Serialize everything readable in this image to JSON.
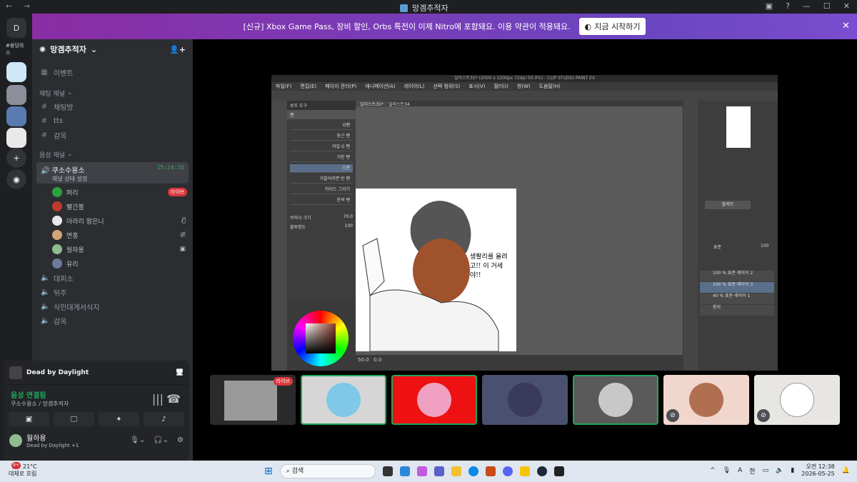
{
  "window": {
    "title": "망겜추적자",
    "nav": "← →"
  },
  "banner": {
    "text": "[신규] Xbox Game Pass, 장비 할인, Orbs 특전이 이제 Nitro에 포함돼요. 이용 약관이 적용돼요.",
    "button": "지금 시작하기",
    "close": "✕"
  },
  "servers": [
    {
      "name": "discord-home",
      "label": "D"
    },
    {
      "name": "server-1",
      "label": "#용딩의스"
    }
  ],
  "sidebar": {
    "guild_name": "망겜추적자",
    "events": "이벤트",
    "text_category": "채팅 채널",
    "text_channels": [
      "채팅방",
      "tts",
      "감옥"
    ],
    "voice_category": "음성 채널",
    "active_voice": {
      "name": "쿠소수용소",
      "time": "15:24:35",
      "status": "채널 상태 설정"
    },
    "voice_users": [
      {
        "name": "퍼리",
        "live": "라이브",
        "color": "#2ea043"
      },
      {
        "name": "빨간볼",
        "color": "#c0392b"
      },
      {
        "name": "아라리 왕은니",
        "color": "#e8e8e8"
      },
      {
        "name": "면홍",
        "color": "#d2a679"
      },
      {
        "name": "월하용",
        "color": "#8fbc8f"
      },
      {
        "name": "유리",
        "color": "#6c7a9c"
      }
    ],
    "other_voice": [
      "대피소",
      "뒤주",
      "식인대게서식지",
      "감옥"
    ]
  },
  "panel": {
    "activity": "Dead by Daylight",
    "voice_connected": "음성 연결됨",
    "voice_location": "쿠소수용소 / 망겜추적자",
    "username": "월하용",
    "user_status": "Dead by Daylight +1"
  },
  "csp": {
    "title": "일러스트35* (2000 x 3200px 72dpi 50.0%) - CLIP STUDIO PAINT EX",
    "menu": [
      "파일(F)",
      "편집(E)",
      "페이지 관리(P)",
      "애니메이션(A)",
      "레이어(L)",
      "선택 범위(S)",
      "표시(V)",
      "필터(I)",
      "창(W)",
      "도움말(H)"
    ],
    "tab1": "일러스트35*",
    "tab2": "일러스트34",
    "subtool_header": "보조 도구",
    "brush_group": "펜",
    "brushes": [
      "G펜",
      "둥근 펜",
      "리얼 G 펜",
      "거친 펜",
      "스푼",
      "거칠어지면 반 펜",
      "하이드 그리기",
      "윤곽 펜"
    ],
    "brush_size_label": "브러시 크기",
    "brush_size": "70.0",
    "opacity_label": "불투명도",
    "opacity": "100",
    "speech": "생활리를 올려고!! 이 거세 야!!",
    "zoom": "50.0",
    "rotate": "0.0",
    "layer_opacity": "100",
    "layers": [
      {
        "name": "100 % 표준 레이어 2"
      },
      {
        "name": "100 % 표준 레이어 3"
      },
      {
        "name": "40 % 표준 레이어 1"
      },
      {
        "name": "용지"
      }
    ],
    "blend": "표준",
    "palette": "팔레트"
  },
  "thumbs": [
    {
      "name": "thumb-screenshare",
      "bg": "#2b2b2b",
      "live": "라이브"
    },
    {
      "name": "thumb-user-1",
      "bg": "#d6d6d6",
      "face": "#7fc8e8"
    },
    {
      "name": "thumb-user-2",
      "bg": "#ee1111",
      "face": "#f0a0c0"
    },
    {
      "name": "thumb-user-3",
      "bg": "#4a5070",
      "face": "#3a3a5a"
    },
    {
      "name": "thumb-user-4",
      "bg": "#5a5a5a",
      "face": "#c8c8c8"
    },
    {
      "name": "thumb-user-5",
      "bg": "#f0d6cc",
      "face": "#b07050",
      "muted": true
    },
    {
      "name": "thumb-user-6",
      "bg": "#e8e6e2",
      "face": "#ffffff",
      "muted": true
    }
  ],
  "taskbar": {
    "weather_temp": "21°C",
    "weather_text": "대체로 흐림",
    "search": "검색",
    "lang": "한",
    "time": "오전 12:38",
    "date": "2026-05-25",
    "badge": "9+"
  }
}
